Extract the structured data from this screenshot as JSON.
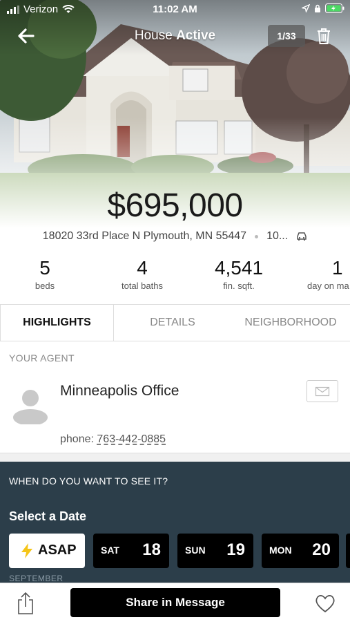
{
  "status_bar": {
    "carrier": "Verizon",
    "time": "11:02 AM"
  },
  "header": {
    "title_prefix": "House",
    "title_status": "Active",
    "photo_count": "1/33"
  },
  "listing": {
    "price": "$695,000",
    "address": "18020 33rd Place N Plymouth, MN 55447",
    "commute": "10..."
  },
  "stats": [
    {
      "value": "5",
      "label": "beds"
    },
    {
      "value": "4",
      "label": "total baths"
    },
    {
      "value": "4,541",
      "label": "fin. sqft."
    },
    {
      "value": "1",
      "label": "day on ma"
    }
  ],
  "tabs": [
    {
      "label": "HIGHLIGHTS",
      "active": true
    },
    {
      "label": "DETAILS",
      "active": false
    },
    {
      "label": "NEIGHBORHOOD",
      "active": false
    }
  ],
  "agent": {
    "section_label": "YOUR AGENT",
    "name": "Minneapolis Office",
    "phone_prefix": "phone:",
    "phone": "763-442-0885"
  },
  "schedule": {
    "question": "WHEN DO YOU WANT TO SEE IT?",
    "title": "Select a Date",
    "asap_label": "ASAP",
    "dates": [
      {
        "dow": "SAT",
        "day": "18"
      },
      {
        "dow": "SUN",
        "day": "19"
      },
      {
        "dow": "MON",
        "day": "20"
      }
    ],
    "month": "SEPTEMBER"
  },
  "bottom": {
    "share_label": "Share in Message"
  },
  "colors": {
    "schedule_bg": "#2c3e4a",
    "button_black": "#000000",
    "battery_green": "#4cd964"
  },
  "icons": [
    "signal-icon",
    "wifi-icon",
    "location-arrow-icon",
    "lock-rotation-icon",
    "battery-icon",
    "back-arrow-icon",
    "trash-icon",
    "car-icon",
    "avatar-icon",
    "mail-icon",
    "lightning-icon",
    "share-icon",
    "heart-icon"
  ]
}
